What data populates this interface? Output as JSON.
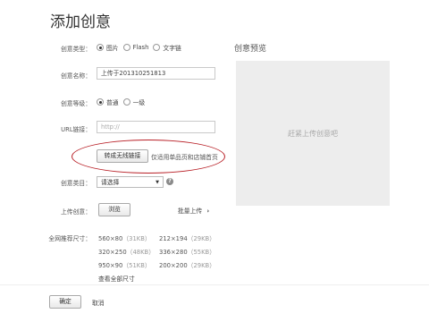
{
  "page": {
    "title": "添加创意"
  },
  "form": {
    "type": {
      "label": "创意类型：",
      "options": [
        {
          "label": "图片",
          "checked": true
        },
        {
          "label": "Flash",
          "checked": false
        },
        {
          "label": "文字链",
          "checked": false
        }
      ]
    },
    "name": {
      "label": "创意名称：",
      "value": "上传于201310251813"
    },
    "level": {
      "label": "创意等级：",
      "options": [
        {
          "label": "普通",
          "checked": true
        },
        {
          "label": "一级",
          "checked": false
        }
      ]
    },
    "url": {
      "label": "URL链接：",
      "placeholder": "http://",
      "convert_button": "转成无线链接",
      "convert_hint": "仅适用单品页和店铺首页"
    },
    "category": {
      "label": "创意类目：",
      "select_value": "请选择",
      "help_icon": "?"
    },
    "upload": {
      "label": "上传创意：",
      "browse_button": "浏览",
      "batch_link": "批量上传",
      "batch_chevron": "chevron-right-icon"
    },
    "sizes": {
      "label": "全网推荐尺寸：",
      "items": [
        {
          "dim": "560×80",
          "kb": "（31KB）"
        },
        {
          "dim": "212×194",
          "kb": "（29KB）"
        },
        {
          "dim": "320×250",
          "kb": "（48KB）"
        },
        {
          "dim": "336×280",
          "kb": "（55KB）"
        },
        {
          "dim": "950×90",
          "kb": "（51KB）"
        },
        {
          "dim": "200×200",
          "kb": "（29KB）"
        }
      ],
      "view_all": "查看全部尺寸"
    }
  },
  "preview": {
    "title": "创意预览",
    "placeholder": "赶紧上传创意吧"
  },
  "footer": {
    "confirm": "确定",
    "cancel": "取消"
  },
  "colors": {
    "highlight_ellipse": "#b81f26",
    "preview_bg": "#ededed"
  }
}
